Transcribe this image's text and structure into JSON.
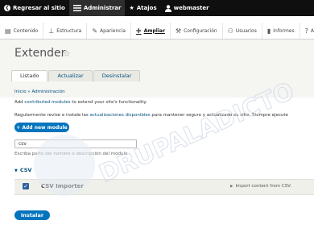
{
  "toolbar": {
    "back_label": "Regresar al sitio",
    "admin_label": "Administrar",
    "shortcuts_label": "Atajos",
    "user_label": "webmaster"
  },
  "tray": {
    "items": [
      "Contenido",
      "Estructura",
      "Apariencia",
      "Ampliar",
      "Configuración",
      "Usuarios",
      "Informes",
      "A"
    ]
  },
  "page": {
    "title": "Extender",
    "tabs": [
      "Listado",
      "Actualizar",
      "Desinstalar"
    ]
  },
  "breadcrumb": {
    "home": "Inicio",
    "sep": "»",
    "current": "Administración"
  },
  "help": {
    "before": "Add ",
    "link": "contributed modules",
    "after": " to extend your site's functionality."
  },
  "notice": {
    "before": "Regularmente revise e instale las ",
    "link": "actualizaciones disponibles",
    "after": " para mantener seguro y actualizado su sitio. Siempre ejecute"
  },
  "add_button": "+ Add new module",
  "filter": {
    "value": "csv",
    "description": "Escriba parte del nombre o descripción del módulo"
  },
  "group": {
    "label": "CSV"
  },
  "module": {
    "name": "CSV Importer",
    "description": "Import content from CSV.",
    "checked": true
  },
  "install_button": "Instalar",
  "watermark": "DRUPALADICTO",
  "colors": {
    "toolbar_bg": "#0f0f0f",
    "accent": "#0074bd",
    "link": "#004f80"
  }
}
